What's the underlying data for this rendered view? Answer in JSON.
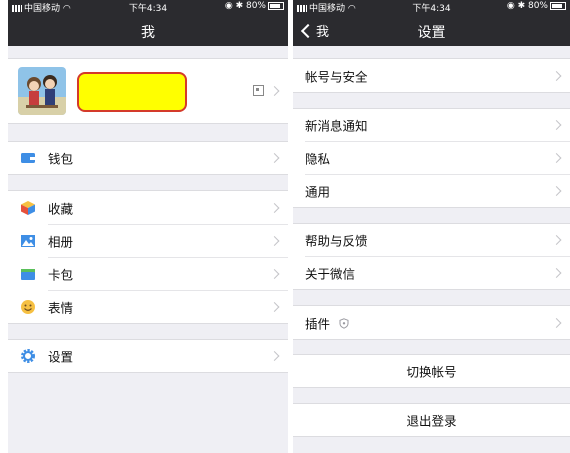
{
  "left": {
    "status": {
      "carrier": "中国移动",
      "time": "下午4:34",
      "battery": "80%"
    },
    "title": "我",
    "menu": [
      {
        "label": "钱包",
        "icon": "wallet-icon"
      },
      {
        "label": "收藏",
        "icon": "favorites-cube-icon"
      },
      {
        "label": "相册",
        "icon": "album-icon"
      },
      {
        "label": "卡包",
        "icon": "card-package-icon"
      },
      {
        "label": "表情",
        "icon": "smiley-icon"
      },
      {
        "label": "设置",
        "icon": "gear-icon"
      }
    ]
  },
  "right": {
    "status": {
      "carrier": "中国移动",
      "time": "下午4:34",
      "battery": "80%"
    },
    "title": "设置",
    "back_label": "我",
    "items": [
      {
        "label": "帐号与安全"
      },
      {
        "label": "新消息通知"
      },
      {
        "label": "隐私"
      },
      {
        "label": "通用"
      },
      {
        "label": "帮助与反馈"
      },
      {
        "label": "关于微信"
      },
      {
        "label": "插件",
        "icon": "shield-icon"
      }
    ],
    "switch_account": "切换帐号",
    "logout": "退出登录"
  },
  "colors": {
    "navbar": "#2b2b2f",
    "background": "#efeff4",
    "highlight": "#ffff00",
    "highlight_border": "#d43a2a"
  }
}
